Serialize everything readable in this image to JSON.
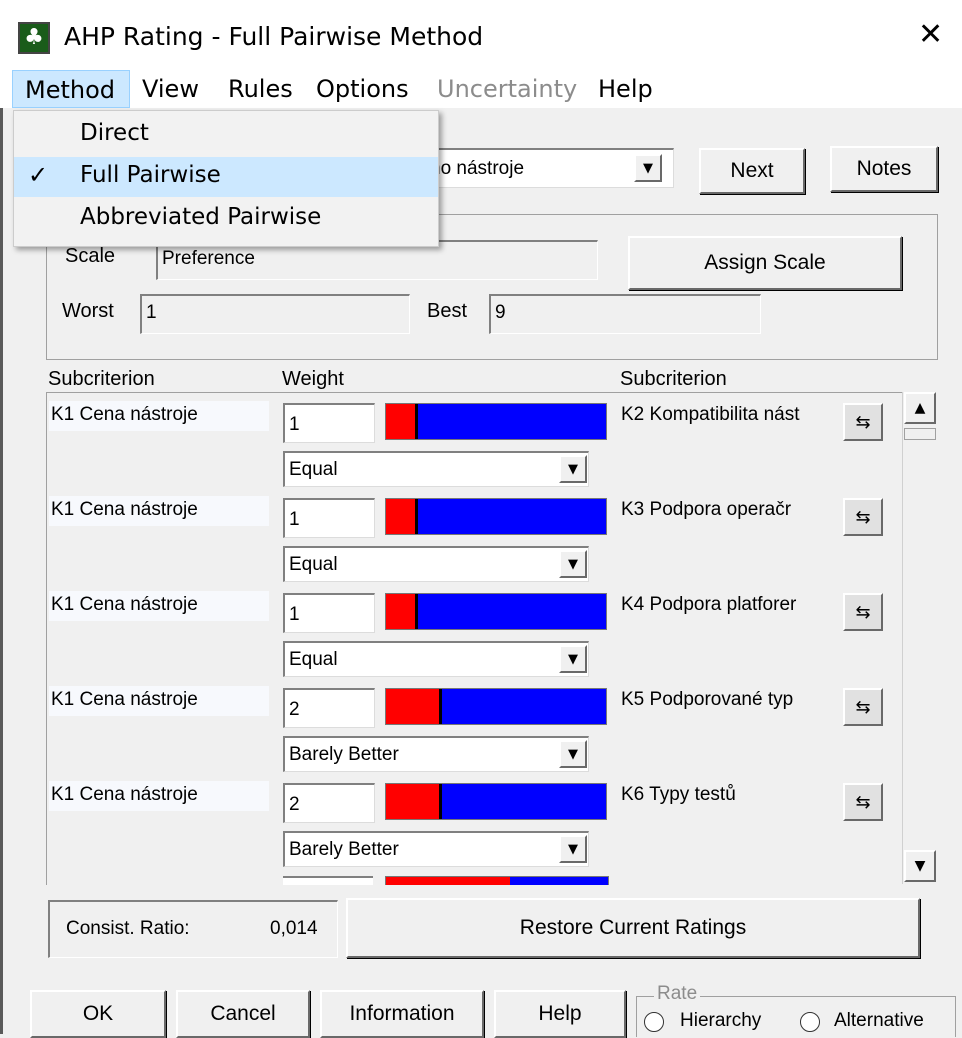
{
  "window": {
    "title": "AHP Rating - Full Pairwise Method",
    "close_glyph": "✕",
    "app_icon_glyph": "♣"
  },
  "menu": [
    {
      "label": "Method"
    },
    {
      "label": "View"
    },
    {
      "label": "Rules"
    },
    {
      "label": "Options"
    },
    {
      "label": "Uncertainty"
    },
    {
      "label": "Help"
    }
  ],
  "method_menu": {
    "items": [
      {
        "label": "Direct"
      },
      {
        "label": "Full Pairwise",
        "checkmark": "✓"
      },
      {
        "label": "Abbreviated Pairwise"
      }
    ]
  },
  "criterion_select": {
    "value": "ho nástroje"
  },
  "buttons": {
    "next": "Next",
    "notes": "Notes",
    "assign_scale": "Assign Scale",
    "restore": "Restore Current Ratings",
    "ok": "OK",
    "cancel": "Cancel",
    "information": "Information",
    "help": "Help"
  },
  "scale": {
    "label": "Scale",
    "value": "Preference",
    "worst_label": "Worst",
    "worst_value": "1",
    "best_label": "Best",
    "best_value": "9"
  },
  "columns": {
    "left": "Subcriterion",
    "weight": "Weight",
    "right": "Subcriterion"
  },
  "rows": [
    {
      "left": "K1 Cena nástroje",
      "weight": "1",
      "right": "K2 Kompatibilita nást",
      "rating": "Equal",
      "left_share": 0.13
    },
    {
      "left": "K1 Cena nástroje",
      "weight": "1",
      "right": "K3 Podpora operačr",
      "rating": "Equal",
      "left_share": 0.13
    },
    {
      "left": "K1 Cena nástroje",
      "weight": "1",
      "right": "K4 Podpora platforer",
      "rating": "Equal",
      "left_share": 0.13
    },
    {
      "left": "K1 Cena nástroje",
      "weight": "2",
      "right": "K5 Podporované typ",
      "rating": "Barely Better",
      "left_share": 0.24
    },
    {
      "left": "K1 Cena nástroje",
      "weight": "2",
      "right": "K6 Typy testů",
      "rating": "Barely Better",
      "left_share": 0.24
    }
  ],
  "consistency": {
    "label": "Consist. Ratio:",
    "value": "0,014"
  },
  "rate_group": {
    "legend": "Rate",
    "option1": "Hierarchy",
    "option2": "Alternative"
  },
  "icons": {
    "swap": "⇆",
    "scroll_up": "▲",
    "scroll_down": "▼",
    "combo_arrow": "▼"
  },
  "colors": {
    "red": "#ff0000",
    "blue": "#0000ff",
    "menu_highlight": "#cce8ff"
  }
}
